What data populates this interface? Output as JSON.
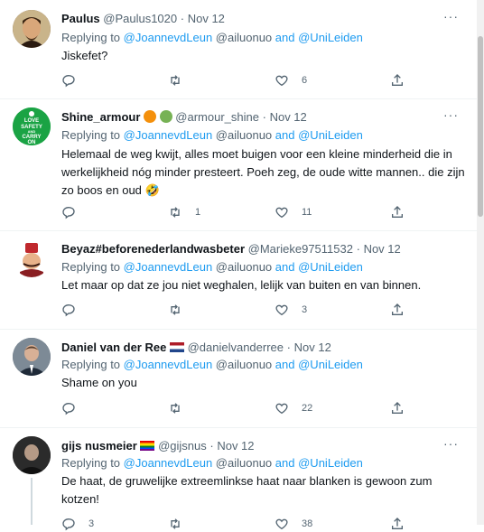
{
  "tweets": [
    {
      "name": "Paulus",
      "handle": "@Paulus1020",
      "time": "Nov 12",
      "replying_prefix": "Replying to",
      "replying_user1": "@JoannevdLeun",
      "replying_user2": "@ailuonuo",
      "replying_and": "and",
      "replying_user3": "@UniLeiden",
      "text": "Jiskefet?",
      "counts": {
        "reply": "",
        "retweet": "",
        "like": "6"
      },
      "avatar_icon": "portrait-avatar"
    },
    {
      "name": "Shine_armour",
      "handle": "@armour_shine",
      "time": "Nov 12",
      "replying_prefix": "Replying to",
      "replying_user1": "@JoannevdLeun",
      "replying_user2": "@ailuonuo",
      "replying_and": "and",
      "replying_user3": "@UniLeiden",
      "text": "Helemaal de weg kwijt, alles moet buigen voor een kleine minderheid die in werkelijkheid nóg minder presteert. Poeh zeg, de oude witte mannen.. die zijn zo boos en oud 🤣",
      "counts": {
        "reply": "",
        "retweet": "1",
        "like": "11"
      },
      "avatar_text": [
        "LOVE",
        "SAFETY",
        "AND",
        "CARRY",
        "ON"
      ],
      "avatar_icon": "keep-calm-avatar"
    },
    {
      "name": "Beyaz#beforenederlandwasbeter",
      "handle": "@Marieke97511532",
      "time": "Nov 12",
      "replying_prefix": "Replying to",
      "replying_user1": "@JoannevdLeun",
      "replying_user2": "@ailuonuo",
      "replying_and": "and",
      "replying_user3": "@UniLeiden",
      "text": "Let maar op dat ze jou niet weghalen, lelijk van buiten en van binnen.",
      "counts": {
        "reply": "",
        "retweet": "",
        "like": "3"
      },
      "avatar_icon": "fez-character-avatar"
    },
    {
      "name": "Daniel van der Ree",
      "handle": "@danielvanderree",
      "time": "Nov 12",
      "replying_prefix": "Replying to",
      "replying_user1": "@JoannevdLeun",
      "replying_user2": "@ailuonuo",
      "replying_and": "and",
      "replying_user3": "@UniLeiden",
      "text": "Shame on you",
      "counts": {
        "reply": "",
        "retweet": "",
        "like": "22"
      },
      "avatar_icon": "man-in-suit-avatar"
    },
    {
      "name": "gijs nusmeier",
      "handle": "@gijsnus",
      "time": "Nov 12",
      "replying_prefix": "Replying to",
      "replying_user1": "@JoannevdLeun",
      "replying_user2": "@ailuonuo",
      "replying_and": "and",
      "replying_user3": "@UniLeiden",
      "text": "De haat, de gruwelijke extreemlinkse haat naar blanken is gewoon zum kotzen!",
      "counts": {
        "reply": "3",
        "retweet": "",
        "like": "38"
      },
      "avatar_icon": "man-dark-avatar"
    }
  ],
  "dot": "·",
  "more_label": "···",
  "colors": {
    "link": "#1d9bf0",
    "muted": "#536471",
    "text": "#0f1419",
    "border": "#eff3f4"
  }
}
